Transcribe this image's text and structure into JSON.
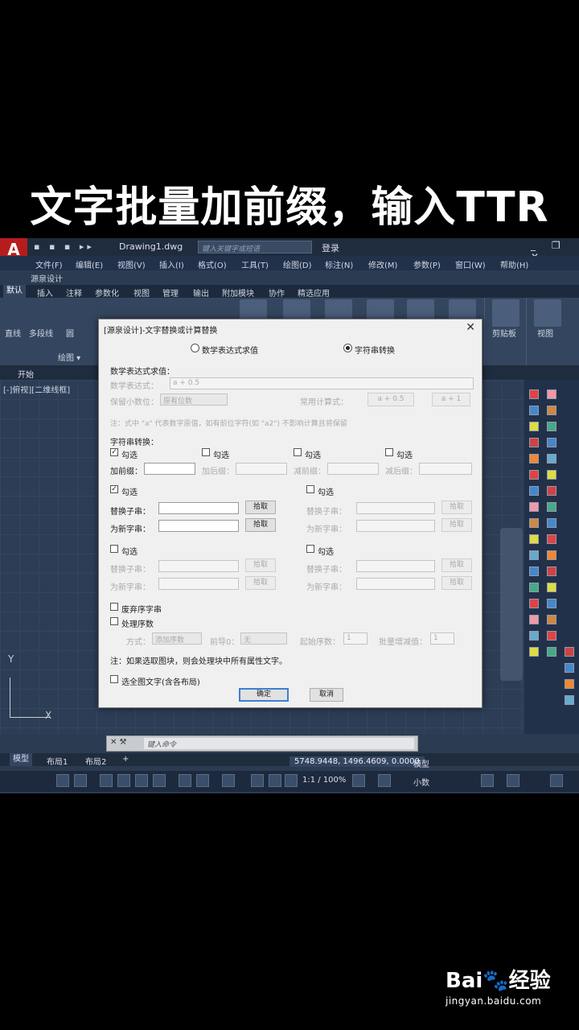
{
  "caption": "文字批量加前缀，输入TTR",
  "app": {
    "logo": "A",
    "quick_access": "▪ ▪ ▪ ▸▸",
    "doc_title": "Drawing1.dwg",
    "search_placeholder": "键入关键字或短语",
    "login": "登录",
    "window_controls": "_ ❐ ✕"
  },
  "menu": [
    "文件(F)",
    "编辑(E)",
    "视图(V)",
    "插入(I)",
    "格式(O)",
    "工具(T)",
    "绘图(D)",
    "标注(N)",
    "修改(M)",
    "参数(P)",
    "窗口(W)",
    "帮助(H)"
  ],
  "submenu": "源泉设计",
  "ribbon_tabs": [
    "默认",
    "插入",
    "注释",
    "参数化",
    "视图",
    "管理",
    "输出",
    "附加模块",
    "协作",
    "精选应用"
  ],
  "ribbon_labels": {
    "draw": "绘图 ▾",
    "line": "直线",
    "polyline": "多段线",
    "circle": "圆",
    "clipboard": "剪贴板",
    "view": "视图"
  },
  "file_tab": "开始",
  "view_label": "[-]俯视][二维线框]",
  "ucs": {
    "x": "X",
    "y": "Y"
  },
  "command_placeholder": "键入命令",
  "layout_tabs": [
    "模型",
    "布局1",
    "布局2",
    "+"
  ],
  "coords": "5748.9448, 1496.4609, 0.0000",
  "status": {
    "model": "模型",
    "scale": "1:1 / 100%",
    "units": "小数"
  },
  "dialog": {
    "title": "[源泉设计]-文字替换或计算替换",
    "mode_math": "数学表达式求值",
    "mode_string": "字符串转换",
    "math_section": "数学表达式求值：",
    "expr_label": "数学表达式：",
    "expr_value": "a + 0.5",
    "keep_label": "保留小数位：",
    "keep_value": "原有位数",
    "common_label": "常用计算式：",
    "common_btn1": "a + 0.5",
    "common_btn2": "a + 1",
    "note1": "注：式中 \"a\" 代表数字原值，如有前位字符(如 \"a2\") 不影响计算且将保留",
    "string_section": "字符串转换：",
    "check": "勾选",
    "prefix_label": "加前缀：",
    "suffix_label": "加后缀：",
    "del_prefix_label": "减前缀：",
    "del_suffix_label": "减后缀：",
    "replace_label": "替换子串：",
    "new_label": "为新字串：",
    "pick": "拾取",
    "discard_label": "废弃序字串",
    "seq_label": "处理序数",
    "method_label": "方式：",
    "method_value": "添加序数",
    "prefix0_label": "前导0：",
    "prefix0_value": "无",
    "start_label": "起始序数：",
    "start_value": "1",
    "step_label": "批量增减值：",
    "step_value": "1",
    "note2": "注：如果选取图块，则会处理块中所有属性文字。",
    "select_all": "选全图文字(含各布局)",
    "ok": "确定",
    "cancel": "取消"
  },
  "watermark": {
    "brand": "Bai🐾经验",
    "url": "jingyan.baidu.com"
  }
}
